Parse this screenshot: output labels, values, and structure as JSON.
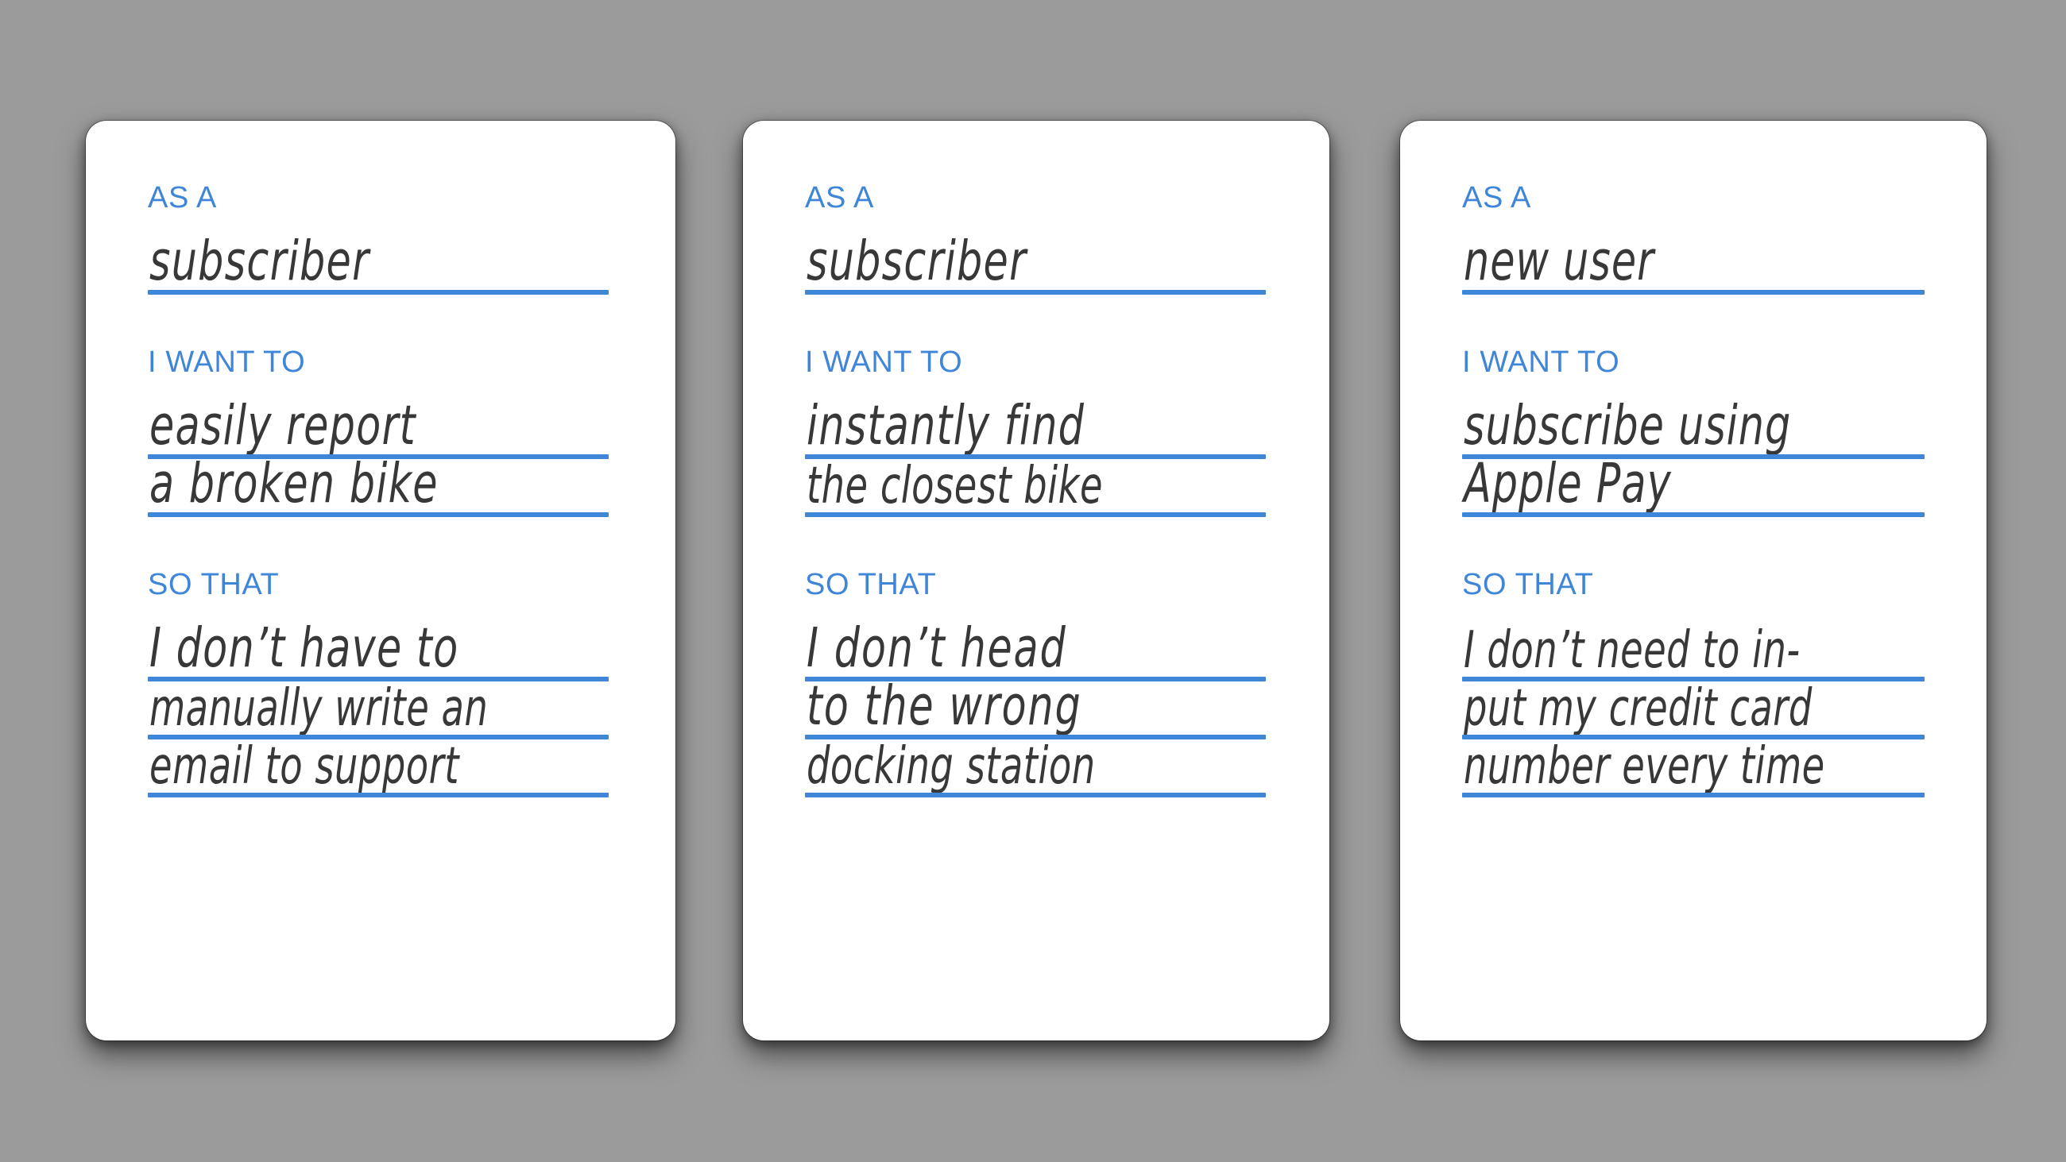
{
  "canvas": {
    "background_color": "#9b9b9b",
    "card_background": "#ffffff",
    "accent_color": "#3f86d8",
    "handwriting_color": "#383838"
  },
  "labels": {
    "as_a": "AS A",
    "i_want_to": "I WANT TO",
    "so_that": "SO THAT"
  },
  "cards": [
    {
      "as_a": [
        "subscriber"
      ],
      "i_want_to": [
        "easily report",
        "a broken bike"
      ],
      "so_that": [
        "I don’t have to",
        "manually write an",
        "email to support"
      ]
    },
    {
      "as_a": [
        "subscriber"
      ],
      "i_want_to": [
        "instantly find",
        "the closest  bike"
      ],
      "so_that": [
        "I don’t head",
        "to the wrong",
        "docking station"
      ]
    },
    {
      "as_a": [
        "new user"
      ],
      "i_want_to": [
        "subscribe using",
        "Apple Pay"
      ],
      "so_that": [
        "I don’t need to in-",
        "put my credit card",
        "number every time"
      ]
    }
  ]
}
